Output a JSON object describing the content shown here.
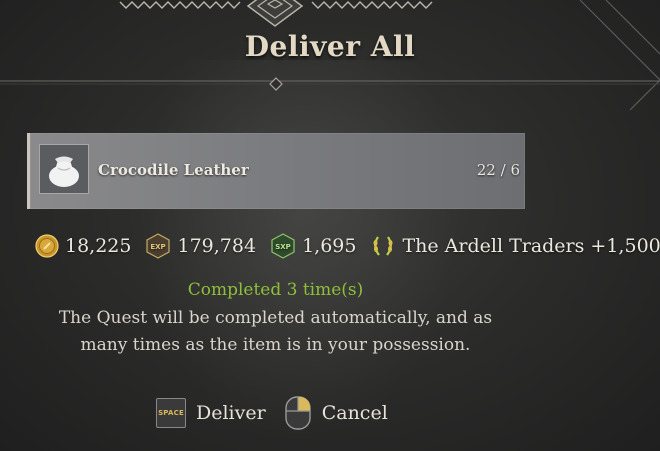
{
  "dialog": {
    "title": "Deliver All"
  },
  "item": {
    "name": "Crocodile Leather",
    "count": "22 / 6",
    "icon": "leather-bag-icon"
  },
  "rewards": {
    "gold": {
      "icon": "gold-coin-icon",
      "value": "18,225"
    },
    "exp": {
      "icon": "exp-badge-icon",
      "badge_text": "EXP",
      "value": "179,784"
    },
    "sxp": {
      "icon": "sxp-badge-icon",
      "badge_text": "SXP",
      "value": "1,695"
    },
    "reputation": {
      "icon": "laurel-icon",
      "text": "The Ardell Traders +1,500"
    }
  },
  "status": {
    "completed": "Completed 3 time(s)",
    "description_line1": "The Quest will be completed automatically, and as",
    "description_line2": "many times as the item is in your possession."
  },
  "actions": {
    "deliver_key": "SPACE",
    "deliver_label": "Deliver",
    "cancel_icon": "mouse-right-click-icon",
    "cancel_label": "Cancel"
  },
  "colors": {
    "completed": "#8fbf3a",
    "key_text": "#d8b95b",
    "title": "#e2d8c4"
  }
}
